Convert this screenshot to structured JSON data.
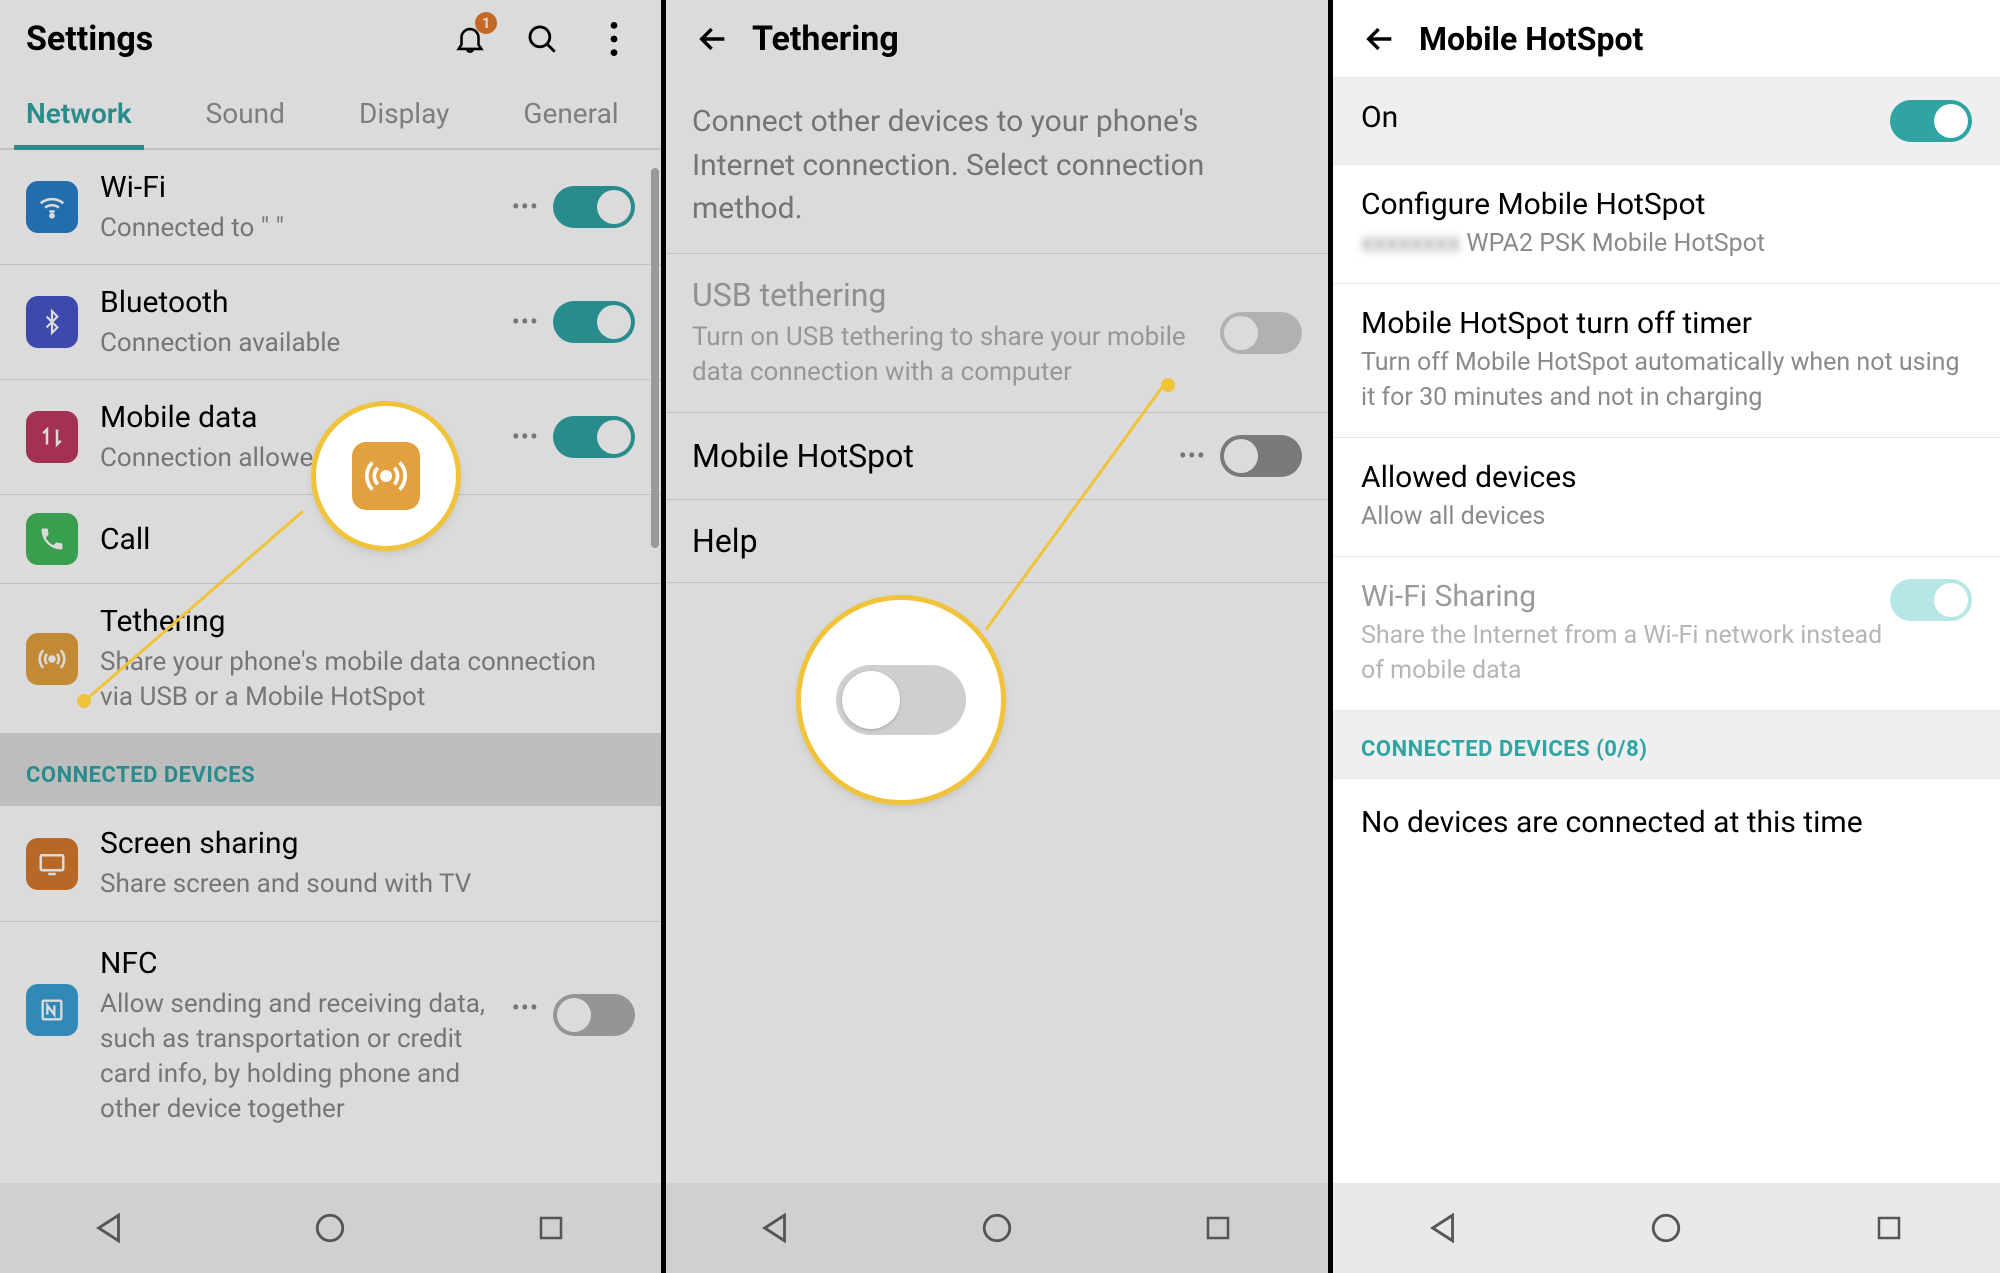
{
  "pane1": {
    "title": "Settings",
    "notification_badge": "1",
    "tabs": [
      "Network",
      "Sound",
      "Display",
      "General"
    ],
    "active_tab": 0,
    "items": [
      {
        "key": "wifi",
        "title": "Wi-Fi",
        "sub": "Connected to \"                  \"",
        "toggle": "on",
        "more": true
      },
      {
        "key": "bt",
        "title": "Bluetooth",
        "sub": "Connection available",
        "toggle": "on",
        "more": true
      },
      {
        "key": "mob",
        "title": "Mobile data",
        "sub": "Connection allowed",
        "toggle": "on",
        "more": true
      },
      {
        "key": "call",
        "title": "Call"
      },
      {
        "key": "teth",
        "title": "Tethering",
        "sub": "Share your phone's mobile data connection via USB or a Mobile HotSpot"
      }
    ],
    "section": "CONNECTED DEVICES",
    "items2": [
      {
        "key": "scr",
        "title": "Screen sharing",
        "sub": "Share screen and sound with TV"
      },
      {
        "key": "nfc",
        "title": "NFC",
        "sub": "Allow sending and receiving data, such as transportation or credit card info, by holding phone and other device together",
        "toggle": "off",
        "more": true
      }
    ]
  },
  "pane2": {
    "title": "Tethering",
    "desc": "Connect other devices to your phone's Internet connection. Select connection method.",
    "items": [
      {
        "key": "usb",
        "title": "USB tethering",
        "sub": "Turn on USB tethering to share your mobile data connection with a computer",
        "toggle": "off-dis",
        "disabled": true
      },
      {
        "key": "mhs",
        "title": "Mobile HotSpot",
        "toggle": "off",
        "more": true
      },
      {
        "key": "help",
        "title": "Help"
      }
    ]
  },
  "pane3": {
    "title": "Mobile HotSpot",
    "on_label": "On",
    "items": [
      {
        "key": "cfg",
        "title": "Configure Mobile HotSpot",
        "sub": "               WPA2 PSK Mobile HotSpot"
      },
      {
        "key": "timer",
        "title": "Mobile HotSpot turn off timer",
        "sub": "Turn off Mobile HotSpot automatically when not using it for 30 minutes and not in charging"
      },
      {
        "key": "allowed",
        "title": "Allowed devices",
        "sub": "Allow all devices"
      },
      {
        "key": "wifishare",
        "title": "Wi-Fi Sharing",
        "sub": "Share the Internet from a Wi-Fi network instead of mobile data",
        "toggle": "teal-dis",
        "disabled": true
      }
    ],
    "section": "CONNECTED DEVICES (0/8)",
    "none": "No devices are connected at this time"
  }
}
